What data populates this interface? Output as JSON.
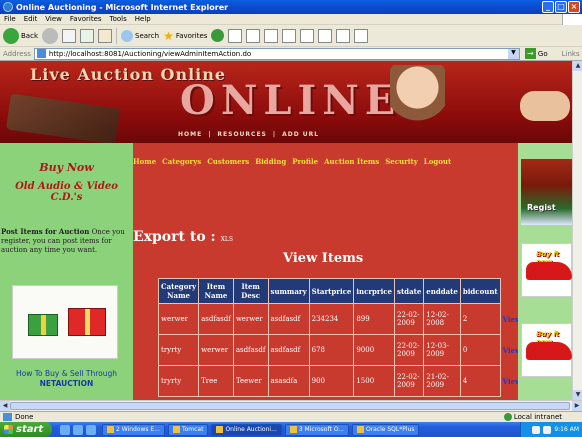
{
  "window": {
    "title": "Online Auctioning - Microsoft Internet Explorer"
  },
  "menu": [
    "File",
    "Edit",
    "View",
    "Favorites",
    "Tools",
    "Help"
  ],
  "toolbar": {
    "back": "Back",
    "search": "Search",
    "favorites": "Favorites"
  },
  "address": {
    "label": "Address",
    "url": "http://localhost:8081/Auctioning/viewAdminItemAction.do",
    "go": "Go",
    "links": "Links"
  },
  "banner": {
    "live": "Live Auction Online",
    "online": "ONLINE",
    "nav": [
      "HOME",
      "|",
      "RESOURCES",
      "|",
      "ADD URL"
    ]
  },
  "left": {
    "buy_now": "Buy Now",
    "old_audio": "Old Audio & Video C.D.'s",
    "post_bold": "Post Items for Auction",
    "post_text": " Once you register, you can post items for auction any time you want.",
    "howto": "How To Buy & Sell Through",
    "net": "NETAUCTION"
  },
  "nav": [
    "Home",
    "Categorys",
    "Customers",
    "Bidding",
    "Profile",
    "Auction Items",
    "Security",
    "Logout"
  ],
  "export": {
    "label": "Export to :",
    "xls": "XLS"
  },
  "view_title": "View Items",
  "table": {
    "headers": [
      "Category Name",
      "Item Name",
      "Item Desc",
      "summary",
      "Startprice",
      "incrprice",
      "stdate",
      "enddate",
      "bidcount",
      ""
    ],
    "rows": [
      [
        "werwer",
        "asdfasdf",
        "werwer",
        "asdfasdf",
        "234234",
        "899",
        "22-02-2009",
        "12-02-2008",
        "2",
        "View"
      ],
      [
        "tryrty",
        "werwer",
        "asdfasdf",
        "asdfasdf",
        "678",
        "9000",
        "22-02-2009",
        "12-03-2009",
        "0",
        "View"
      ],
      [
        "tryrty",
        "Tree",
        "Teewer",
        "asasdfa",
        "900",
        "1500",
        "22-02-2009",
        "21-02-2009",
        "4",
        "View"
      ]
    ]
  },
  "right": {
    "register": "Regist",
    "buyit": "Buy it now"
  },
  "status": {
    "text": "Done",
    "zone": "Local intranet"
  },
  "taskbar": {
    "start": "start",
    "items": [
      "2 Windows E...",
      "Tomcat",
      "Online Auctioni...",
      "3 Microsoft O...",
      "Oracle SQL*Plus"
    ],
    "time": "9:16 AM"
  }
}
